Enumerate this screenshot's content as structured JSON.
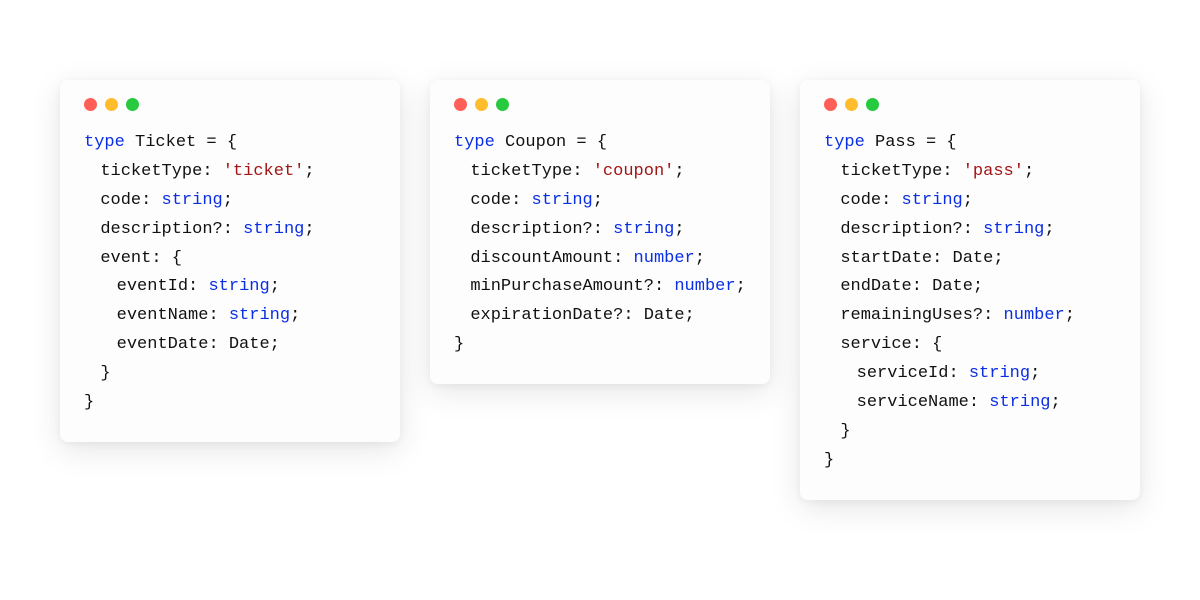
{
  "windows": [
    {
      "id": "ticket",
      "lines": [
        {
          "indent": 0,
          "tokens": [
            {
              "cls": "kw",
              "t": "type"
            },
            {
              "cls": "plain",
              "t": " "
            },
            {
              "cls": "typename",
              "t": "Ticket"
            },
            {
              "cls": "plain",
              "t": " = {"
            }
          ]
        },
        {
          "indent": 1,
          "tokens": [
            {
              "cls": "plain",
              "t": "ticketType: "
            },
            {
              "cls": "str",
              "t": "'ticket'"
            },
            {
              "cls": "punct",
              "t": ";"
            }
          ]
        },
        {
          "indent": 1,
          "tokens": [
            {
              "cls": "plain",
              "t": "code: "
            },
            {
              "cls": "type",
              "t": "string"
            },
            {
              "cls": "punct",
              "t": ";"
            }
          ]
        },
        {
          "indent": 1,
          "tokens": [
            {
              "cls": "plain",
              "t": "description?: "
            },
            {
              "cls": "type",
              "t": "string"
            },
            {
              "cls": "punct",
              "t": ";"
            }
          ]
        },
        {
          "indent": 1,
          "tokens": [
            {
              "cls": "plain",
              "t": "event: {"
            }
          ]
        },
        {
          "indent": 2,
          "tokens": [
            {
              "cls": "plain",
              "t": "eventId: "
            },
            {
              "cls": "type",
              "t": "string"
            },
            {
              "cls": "punct",
              "t": ";"
            }
          ]
        },
        {
          "indent": 2,
          "tokens": [
            {
              "cls": "plain",
              "t": "eventName: "
            },
            {
              "cls": "type",
              "t": "string"
            },
            {
              "cls": "punct",
              "t": ";"
            }
          ]
        },
        {
          "indent": 2,
          "tokens": [
            {
              "cls": "plain",
              "t": "eventDate: Date;"
            }
          ]
        },
        {
          "indent": 1,
          "tokens": [
            {
              "cls": "plain",
              "t": "}"
            }
          ]
        },
        {
          "indent": 0,
          "tokens": [
            {
              "cls": "plain",
              "t": "}"
            }
          ]
        }
      ]
    },
    {
      "id": "coupon",
      "lines": [
        {
          "indent": 0,
          "tokens": [
            {
              "cls": "kw",
              "t": "type"
            },
            {
              "cls": "plain",
              "t": " "
            },
            {
              "cls": "typename",
              "t": "Coupon"
            },
            {
              "cls": "plain",
              "t": " = {"
            }
          ]
        },
        {
          "indent": 1,
          "tokens": [
            {
              "cls": "plain",
              "t": "ticketType: "
            },
            {
              "cls": "str",
              "t": "'coupon'"
            },
            {
              "cls": "punct",
              "t": ";"
            }
          ]
        },
        {
          "indent": 1,
          "tokens": [
            {
              "cls": "plain",
              "t": "code: "
            },
            {
              "cls": "type",
              "t": "string"
            },
            {
              "cls": "punct",
              "t": ";"
            }
          ]
        },
        {
          "indent": 1,
          "tokens": [
            {
              "cls": "plain",
              "t": "description?: "
            },
            {
              "cls": "type",
              "t": "string"
            },
            {
              "cls": "punct",
              "t": ";"
            }
          ]
        },
        {
          "indent": 1,
          "tokens": [
            {
              "cls": "plain",
              "t": "discountAmount: "
            },
            {
              "cls": "type",
              "t": "number"
            },
            {
              "cls": "punct",
              "t": ";"
            }
          ]
        },
        {
          "indent": 1,
          "tokens": [
            {
              "cls": "plain",
              "t": "minPurchaseAmount?: "
            },
            {
              "cls": "type",
              "t": "number"
            },
            {
              "cls": "punct",
              "t": ";"
            }
          ]
        },
        {
          "indent": 1,
          "tokens": [
            {
              "cls": "plain",
              "t": "expirationDate?: Date;"
            }
          ]
        },
        {
          "indent": 0,
          "tokens": [
            {
              "cls": "plain",
              "t": "}"
            }
          ]
        }
      ]
    },
    {
      "id": "pass",
      "lines": [
        {
          "indent": 0,
          "tokens": [
            {
              "cls": "kw",
              "t": "type"
            },
            {
              "cls": "plain",
              "t": " "
            },
            {
              "cls": "typename",
              "t": "Pass"
            },
            {
              "cls": "plain",
              "t": " = {"
            }
          ]
        },
        {
          "indent": 1,
          "tokens": [
            {
              "cls": "plain",
              "t": "ticketType: "
            },
            {
              "cls": "str",
              "t": "'pass'"
            },
            {
              "cls": "punct",
              "t": ";"
            }
          ]
        },
        {
          "indent": 1,
          "tokens": [
            {
              "cls": "plain",
              "t": "code: "
            },
            {
              "cls": "type",
              "t": "string"
            },
            {
              "cls": "punct",
              "t": ";"
            }
          ]
        },
        {
          "indent": 1,
          "tokens": [
            {
              "cls": "plain",
              "t": "description?: "
            },
            {
              "cls": "type",
              "t": "string"
            },
            {
              "cls": "punct",
              "t": ";"
            }
          ]
        },
        {
          "indent": 1,
          "tokens": [
            {
              "cls": "plain",
              "t": "startDate: Date;"
            }
          ]
        },
        {
          "indent": 1,
          "tokens": [
            {
              "cls": "plain",
              "t": "endDate: Date;"
            }
          ]
        },
        {
          "indent": 1,
          "tokens": [
            {
              "cls": "plain",
              "t": "remainingUses?: "
            },
            {
              "cls": "type",
              "t": "number"
            },
            {
              "cls": "punct",
              "t": ";"
            }
          ]
        },
        {
          "indent": 1,
          "tokens": [
            {
              "cls": "plain",
              "t": "service: {"
            }
          ]
        },
        {
          "indent": 2,
          "tokens": [
            {
              "cls": "plain",
              "t": "serviceId: "
            },
            {
              "cls": "type",
              "t": "string"
            },
            {
              "cls": "punct",
              "t": ";"
            }
          ]
        },
        {
          "indent": 2,
          "tokens": [
            {
              "cls": "plain",
              "t": "serviceName: "
            },
            {
              "cls": "type",
              "t": "string"
            },
            {
              "cls": "punct",
              "t": ";"
            }
          ]
        },
        {
          "indent": 1,
          "tokens": [
            {
              "cls": "plain",
              "t": "}"
            }
          ]
        },
        {
          "indent": 0,
          "tokens": [
            {
              "cls": "plain",
              "t": "}"
            }
          ]
        }
      ]
    }
  ]
}
